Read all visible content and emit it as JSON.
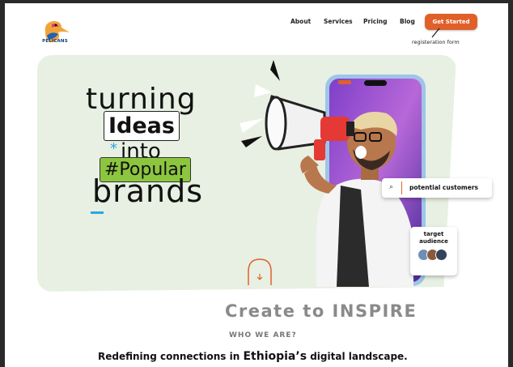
{
  "brand": {
    "name": "PELICANS"
  },
  "nav": {
    "about": "About",
    "services": "Services",
    "pricing": "Pricing",
    "blog": "Blog",
    "cta": "Get Started",
    "cta_note": "registeration form"
  },
  "hero": {
    "line1": "turning",
    "line2": "Ideas",
    "line3": "into",
    "line4": "#Popular",
    "line5": "brands",
    "search_text": "potential customers",
    "target_label": "target\naudience"
  },
  "section": {
    "title": "Create to INSPIRE",
    "subtitle": "WHO WE ARE?",
    "tagline_pre": "Redefining connections in ",
    "tagline_em": "Ethiopia’s",
    "tagline_post": " digital landscape."
  },
  "colors": {
    "accent": "#e0602a",
    "hero_bg": "#e7f0e2",
    "green_tag": "#8cc63f",
    "blue": "#29a8e0"
  },
  "icons": {
    "logo": "pelican-logo",
    "search": "search-icon",
    "scroll": "scroll-down-icon"
  }
}
